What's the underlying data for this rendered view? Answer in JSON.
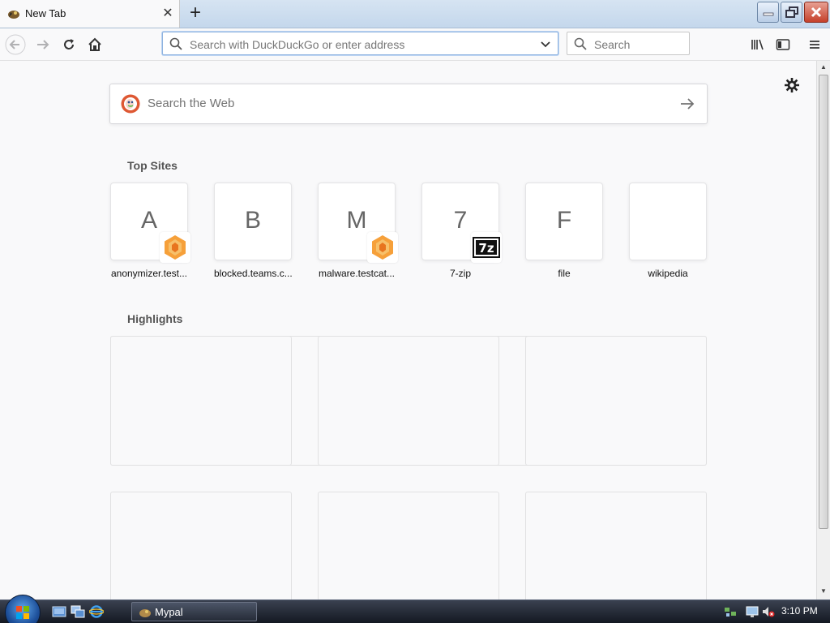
{
  "tab": {
    "title": "New Tab",
    "close_glyph": "✕",
    "new_glyph": "+"
  },
  "window_controls": [
    "minimize-icon",
    "restore-icon",
    "close-icon"
  ],
  "toolbar": {
    "url_placeholder": "Search with DuckDuckGo or enter address",
    "search_placeholder": "Search"
  },
  "content": {
    "web_search_placeholder": "Search the Web",
    "top_sites_title": "Top Sites",
    "highlights_title": "Highlights",
    "top_sites": [
      {
        "letter": "A",
        "label": "anonymizer.test...",
        "badge": "orange-hex"
      },
      {
        "letter": "B",
        "label": "blocked.teams.c...",
        "badge": ""
      },
      {
        "letter": "M",
        "label": "malware.testcat...",
        "badge": "orange-hex"
      },
      {
        "letter": "7",
        "label": "7-zip",
        "badge": "7z"
      },
      {
        "letter": "F",
        "label": "file",
        "badge": ""
      },
      {
        "letter": "",
        "label": "wikipedia",
        "badge": ""
      }
    ]
  },
  "taskbar": {
    "task_label": "Mypal",
    "clock": "3:10 PM"
  },
  "colors": {
    "accent": "#0a84ff",
    "ddg_orange": "#de5833"
  }
}
